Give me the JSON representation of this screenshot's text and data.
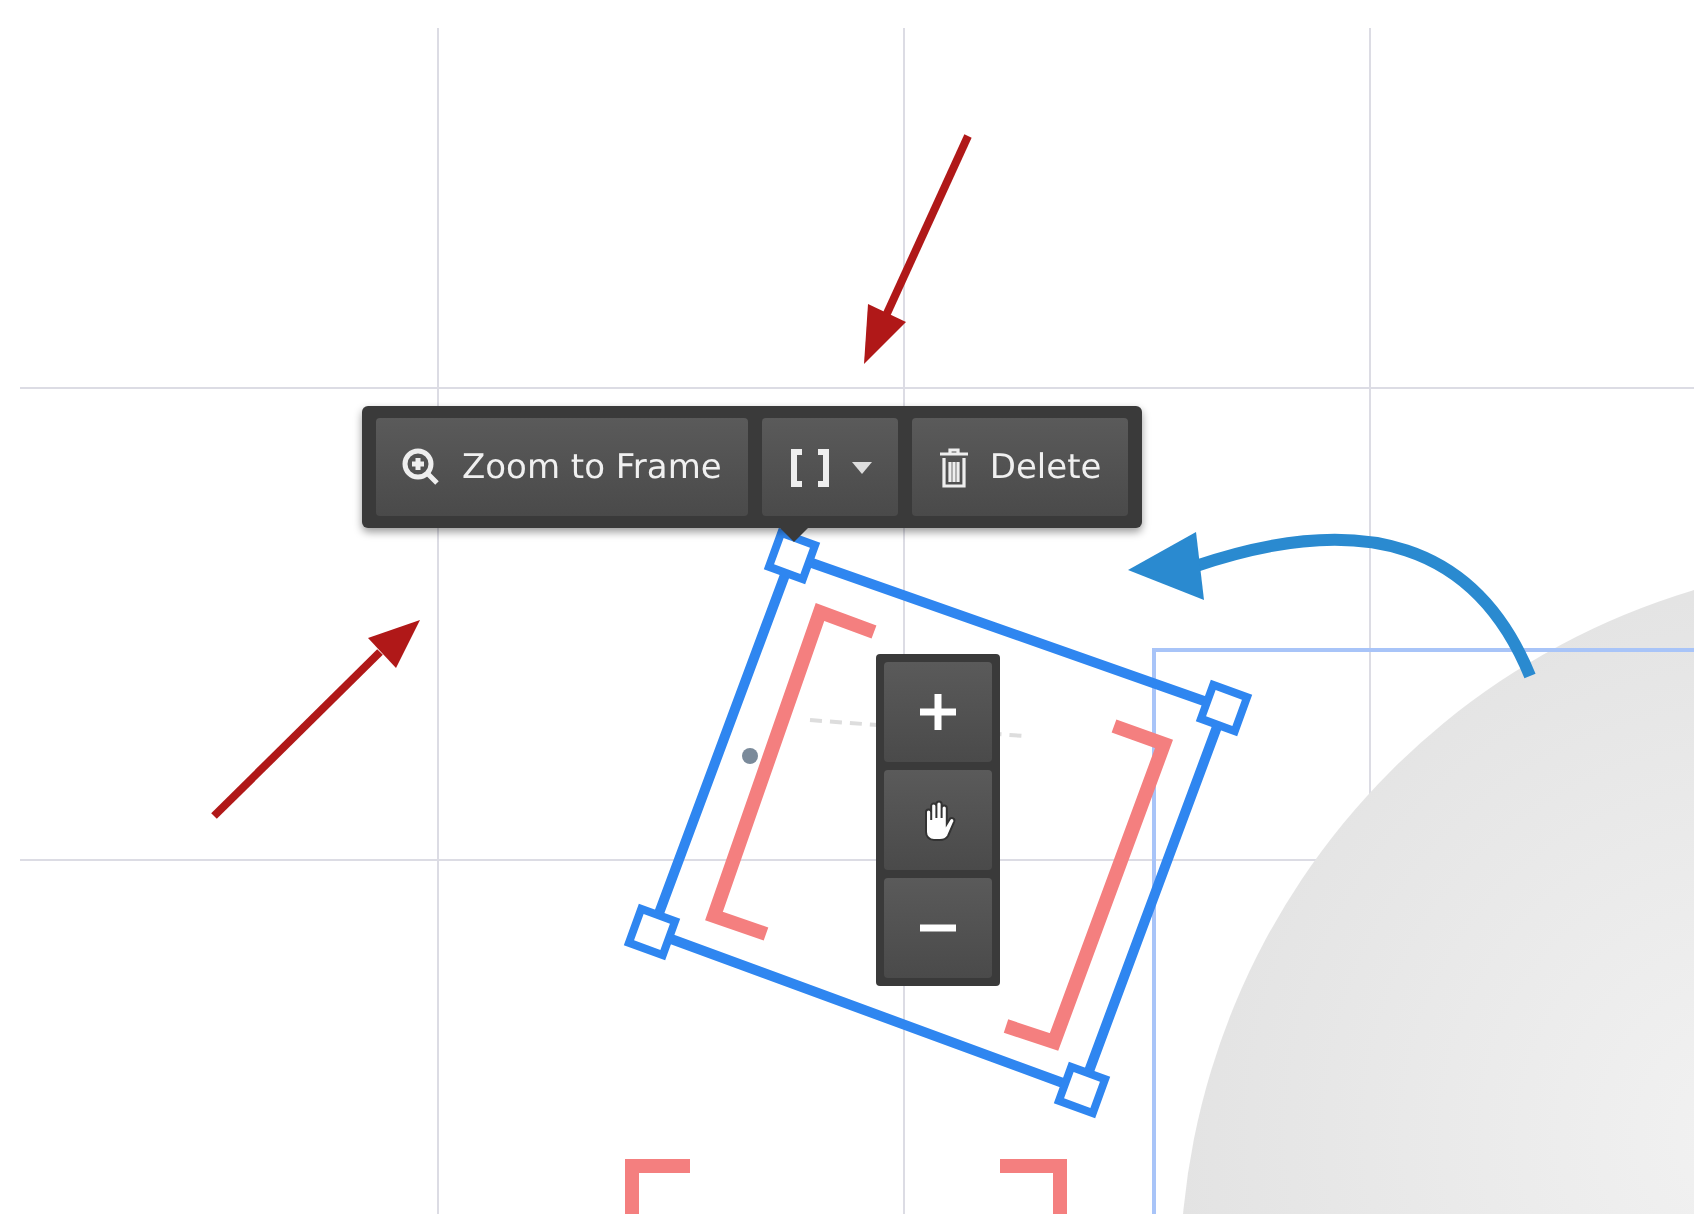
{
  "toolbar": {
    "buttons": [
      {
        "kind": "zoom",
        "label": "Zoom to Frame"
      },
      {
        "kind": "frame-menu"
      },
      {
        "kind": "delete",
        "label": "Delete"
      }
    ]
  },
  "zoom_controls": [
    {
      "kind": "zoom-in"
    },
    {
      "kind": "pan"
    },
    {
      "kind": "zoom-out"
    }
  ]
}
